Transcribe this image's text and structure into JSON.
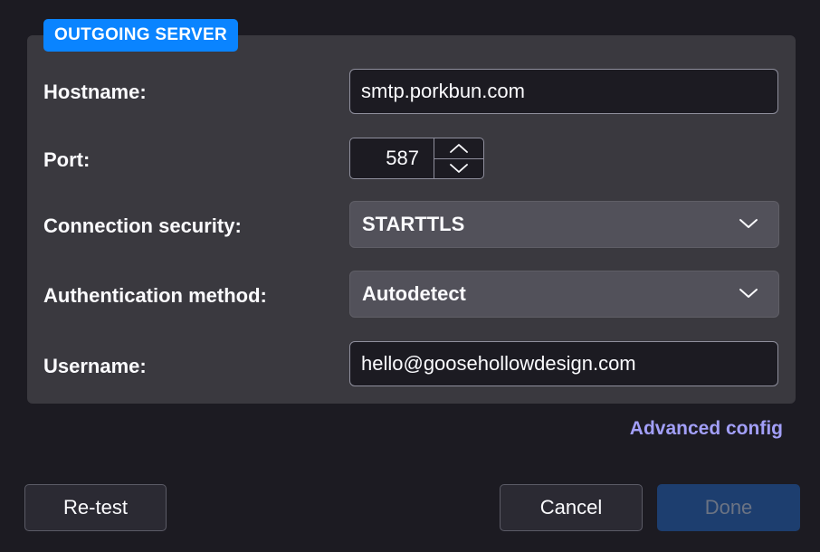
{
  "section": {
    "title": "OUTGOING SERVER"
  },
  "fields": {
    "hostname": {
      "label": "Hostname:",
      "value": "smtp.porkbun.com"
    },
    "port": {
      "label": "Port:",
      "value": "587"
    },
    "connection_security": {
      "label": "Connection security:",
      "value": "STARTTLS"
    },
    "authentication_method": {
      "label": "Authentication method:",
      "value": "Autodetect"
    },
    "username": {
      "label": "Username:",
      "value": "hello@goosehollowdesign.com"
    }
  },
  "links": {
    "advanced_config": "Advanced config"
  },
  "buttons": {
    "retest": "Re-test",
    "cancel": "Cancel",
    "done": "Done"
  },
  "colors": {
    "accent": "#0a84ff",
    "link": "#a29ff8",
    "background": "#1c1b22",
    "panel": "#3a393f"
  },
  "icons": {
    "stepper_up": "chevron-up-icon",
    "stepper_down": "chevron-down-icon",
    "select_arrow": "chevron-down-icon"
  }
}
